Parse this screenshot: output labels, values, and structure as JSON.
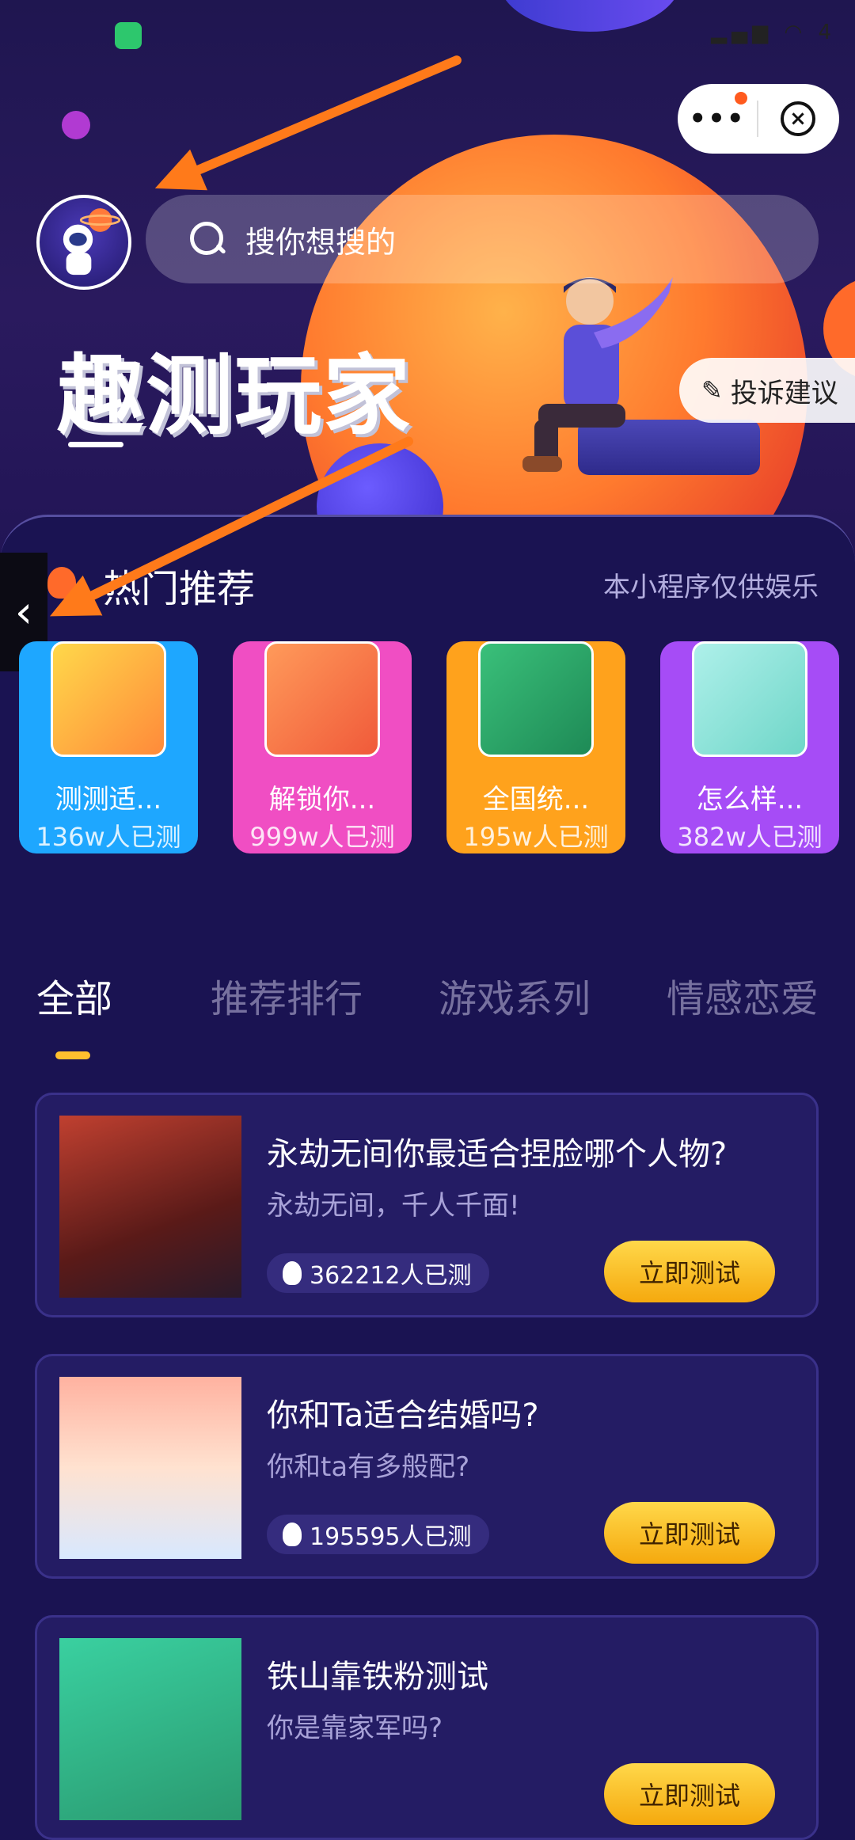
{
  "header": {
    "search_placeholder": "搜你想搜的",
    "app_title": "趣测玩家",
    "feedback_label": "投诉建议",
    "capsule_more": "•••",
    "capsule_close": "×"
  },
  "hot": {
    "title": "热门推荐",
    "disclaimer": "本小程序仅供娱乐",
    "items": [
      {
        "name": "测测适...",
        "count": "136w人已测",
        "color": "#1ea7ff"
      },
      {
        "name": "解锁你...",
        "count": "999w人已测",
        "color": "#f04ec3"
      },
      {
        "name": "全国统...",
        "count": "195w人已测",
        "color": "#ffa21c"
      },
      {
        "name": "怎么样...",
        "count": "382w人已测",
        "color": "#a64cf6"
      }
    ]
  },
  "tabs": [
    "全部",
    "推荐排行",
    "游戏系列",
    "情感恋爱"
  ],
  "tests": [
    {
      "title": "永劫无间你最适合捏脸哪个人物?",
      "subtitle": "永劫无间，千人千面!",
      "count": "362212人已测",
      "button": "立即测试"
    },
    {
      "title": "你和Ta适合结婚吗?",
      "subtitle": "你和ta有多般配?",
      "count": "195595人已测",
      "button": "立即测试"
    },
    {
      "title": "铁山靠铁粉测试",
      "subtitle": "你是靠家军吗?",
      "count": "",
      "button": "立即测试"
    }
  ],
  "status": {
    "battery": "4"
  }
}
